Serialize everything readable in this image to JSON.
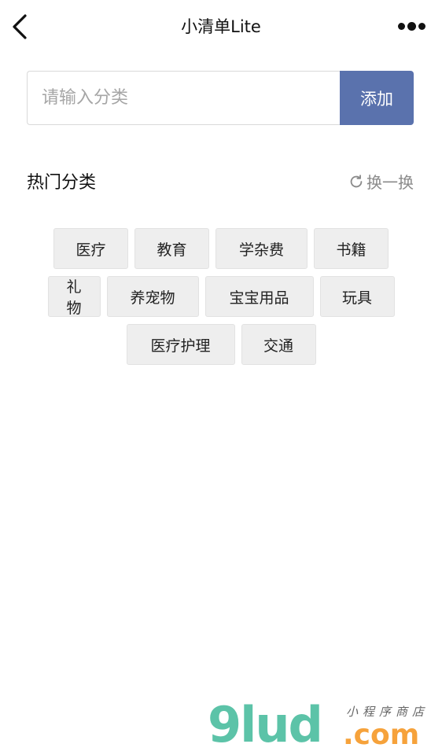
{
  "nav": {
    "title": "小清单Lite",
    "back_icon": "chevron-left-icon",
    "more_icon": "more-dots-icon"
  },
  "add_category": {
    "placeholder": "请输入分类",
    "value": "",
    "button_label": "添加",
    "button_color": "#5a72ad"
  },
  "hot": {
    "title": "热门分类",
    "refresh_label": "换一换",
    "refresh_icon": "refresh-icon",
    "rows": [
      [
        "医疗",
        "教育",
        "学杂费",
        "书籍"
      ],
      [
        "礼物",
        "养宠物",
        "宝宝用品",
        "玩具"
      ],
      [
        "医疗护理",
        "交通"
      ]
    ]
  },
  "watermark": {
    "brand": "9lud",
    "domain": ".com",
    "tagline": "小程序商店"
  }
}
